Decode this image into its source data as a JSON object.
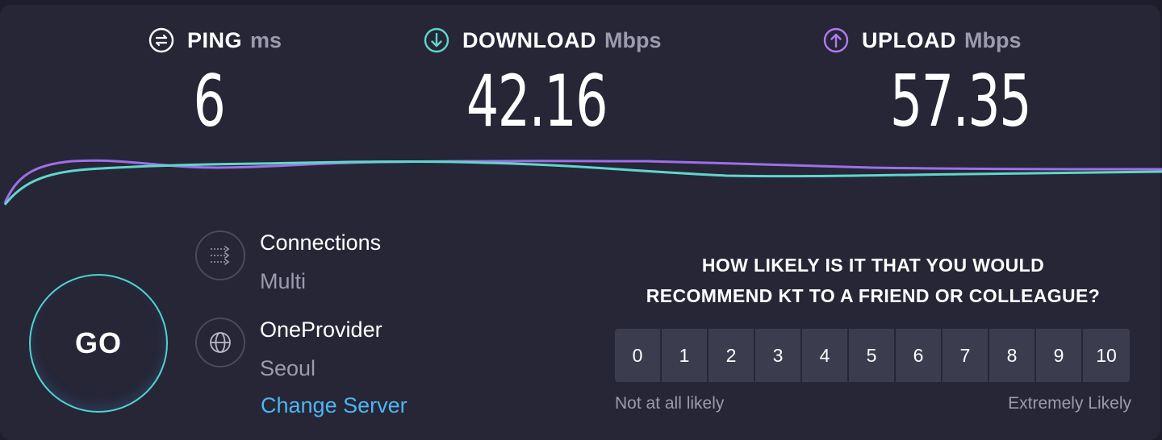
{
  "metrics": {
    "ping": {
      "label": "PING",
      "unit": "ms",
      "value": "6",
      "icon": "ping-icon",
      "color": "#ffffff"
    },
    "download": {
      "label": "DOWNLOAD",
      "unit": "Mbps",
      "value": "42.16",
      "icon": "download-arrow-icon",
      "color": "#5fd6cc"
    },
    "upload": {
      "label": "UPLOAD",
      "unit": "Mbps",
      "value": "57.35",
      "icon": "upload-arrow-icon",
      "color": "#b17bf0"
    }
  },
  "graph": {
    "download_color": "#5fd6cc",
    "upload_color": "#9d6fe8"
  },
  "go_button": {
    "label": "GO"
  },
  "connections": {
    "title": "Connections",
    "value": "Multi",
    "icon": "connections-icon"
  },
  "server": {
    "title": "OneProvider",
    "location": "Seoul",
    "icon": "globe-icon",
    "change_label": "Change Server",
    "link_color": "#4fb4f0"
  },
  "survey": {
    "question_line1": "HOW LIKELY IS IT THAT YOU WOULD",
    "question_line2": "RECOMMEND KT TO A FRIEND OR COLLEAGUE?",
    "options": [
      "0",
      "1",
      "2",
      "3",
      "4",
      "5",
      "6",
      "7",
      "8",
      "9",
      "10"
    ],
    "low_label": "Not at all likely",
    "high_label": "Extremely Likely"
  }
}
